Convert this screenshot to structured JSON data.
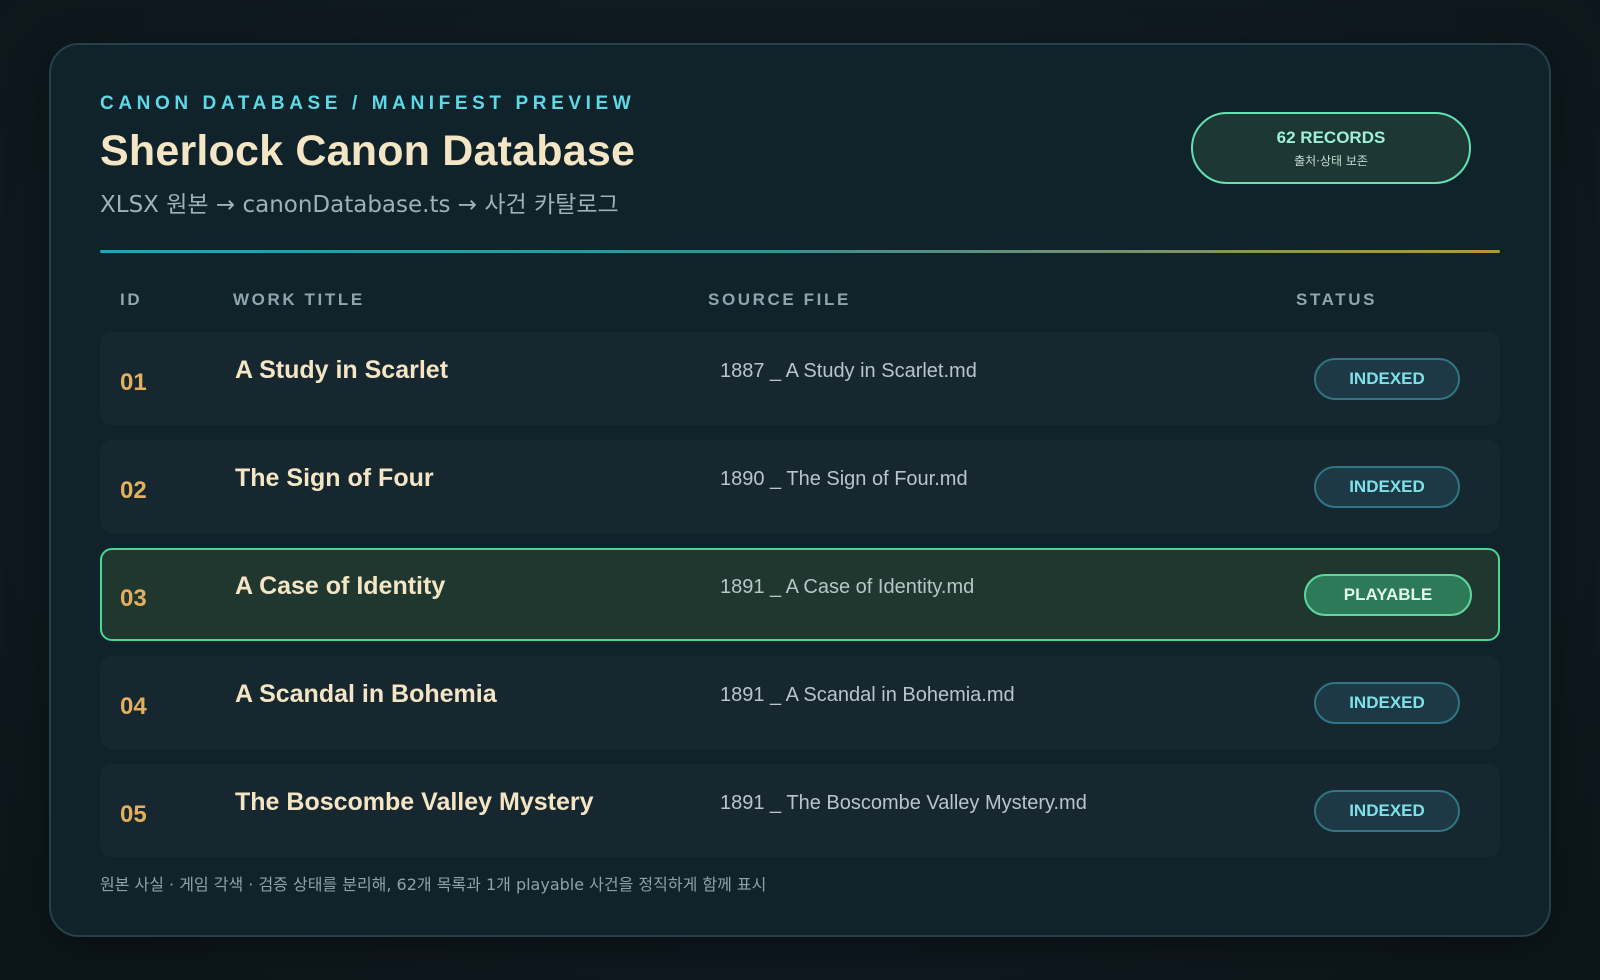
{
  "header": {
    "eyebrow": "CANON DATABASE / MANIFEST PREVIEW",
    "title": "Sherlock Canon Database",
    "subtitle": "XLSX 원본 → canonDatabase.ts → 사건 카탈로그"
  },
  "records_badge": {
    "count": "62 RECORDS",
    "sub": "출처·상태 보존"
  },
  "table": {
    "columns": [
      "ID",
      "WORK TITLE",
      "SOURCE FILE",
      "STATUS"
    ],
    "rows": [
      {
        "id": "01",
        "title": "A Study in Scarlet",
        "file": "1887 _ A Study in Scarlet.md",
        "status": "INDEXED"
      },
      {
        "id": "02",
        "title": "The Sign of Four",
        "file": "1890 _ The Sign of Four.md",
        "status": "INDEXED"
      },
      {
        "id": "03",
        "title": "A Case of Identity",
        "file": "1891 _ A Case of Identity.md",
        "status": "PLAYABLE"
      },
      {
        "id": "04",
        "title": "A Scandal in Bohemia",
        "file": "1891 _ A Scandal in Bohemia.md",
        "status": "INDEXED"
      },
      {
        "id": "05",
        "title": "The Boscombe Valley Mystery",
        "file": "1891 _ The Boscombe Valley Mystery.md",
        "status": "INDEXED"
      }
    ]
  },
  "footer": "원본 사실 · 게임 각색 · 검증 상태를 분리해, 62개 목록과 1개 playable 사건을 정직하게 함께 표시",
  "colors": {
    "accent_cyan": "#5fd8e6",
    "title_cream": "#f4e6c4",
    "id_gold": "#e3b05f",
    "playable_green": "#4cd693"
  }
}
